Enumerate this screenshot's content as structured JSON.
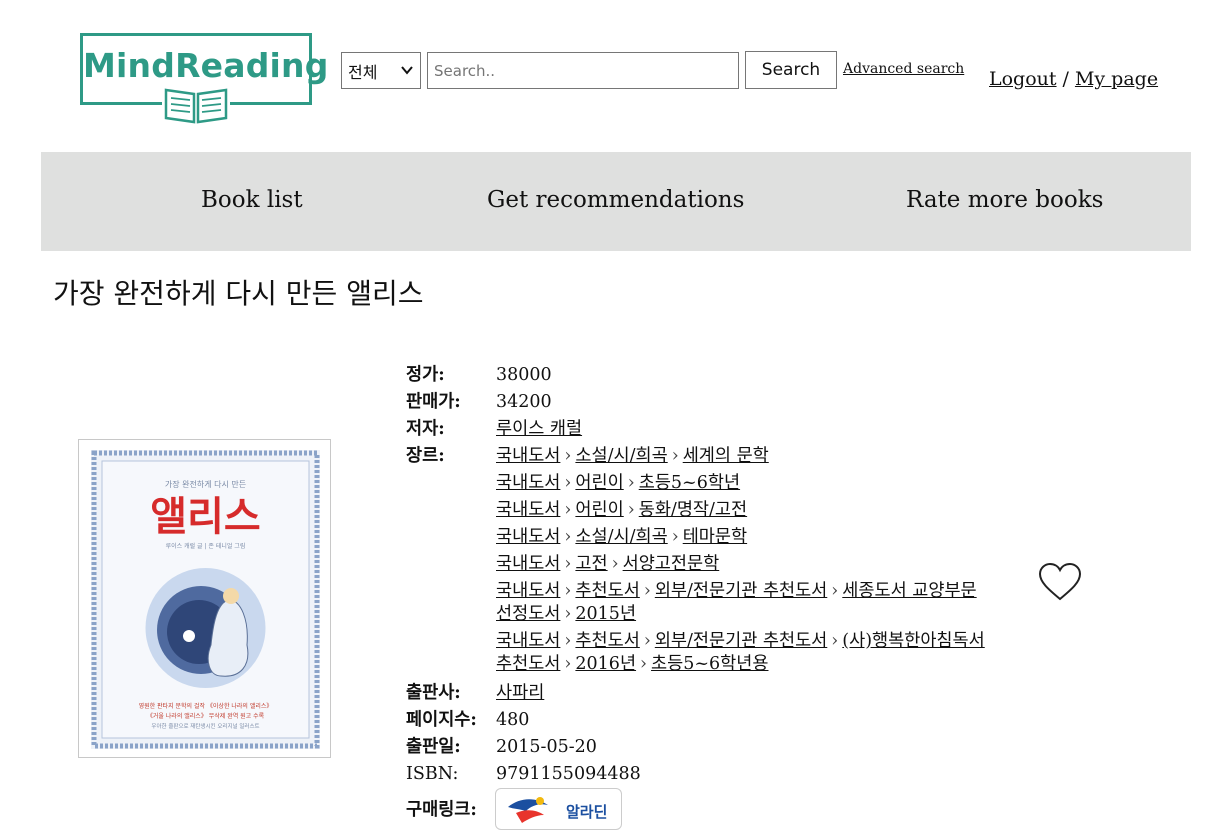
{
  "header": {
    "logo_text": "MindReading",
    "search_category": "전체",
    "search_placeholder": "Search..",
    "search_button": "Search",
    "advanced_search": "Advanced search",
    "logout": "Logout",
    "separator": "/",
    "my_page": "My page"
  },
  "nav": {
    "items": [
      {
        "label": "Book list"
      },
      {
        "label": "Get recommendations"
      },
      {
        "label": "Rate more books"
      }
    ]
  },
  "book": {
    "title": "가장 완전하게 다시 만든 앨리스",
    "cover": {
      "top_line": "가장 완전하게 다시 만든",
      "big_title": "앨리스",
      "credit": "루이스 캐럴 글 | 존 테니얼 그림",
      "blurb1": "영원한 판타지 문학의 걸작 《이상한 나라의 앨리스》",
      "blurb2": "《거울 나라의 앨리스》 무삭제 완역 원고 수록",
      "blurb3": "우아한 줄판으로 재탄생시킨 오리지널 일러스트"
    },
    "fields": {
      "list_price_label": "정가:",
      "list_price": "38000",
      "sale_price_label": "판매가:",
      "sale_price": "34200",
      "author_label": "저자:",
      "author": "루이스 캐럴",
      "genre_label": "장르:",
      "publisher_label": "출판사:",
      "publisher": "사파리",
      "pages_label": "페이지수:",
      "pages": "480",
      "pub_date_label": "출판일:",
      "pub_date": "2015-05-20",
      "isbn_label": "ISBN:",
      "isbn": "9791155094488",
      "buy_label": "구매링크:",
      "buy_store": "알라딘"
    },
    "genres": [
      {
        "g0": "국내도서",
        "g1": "소설/시/희곡",
        "g2": "세계의 문학"
      },
      {
        "g0": "국내도서",
        "g1": "어린이",
        "g2": "초등5~6학년"
      },
      {
        "g0": "국내도서",
        "g1": "어린이",
        "g2": "동화/명작/고전"
      },
      {
        "g0": "국내도서",
        "g1": "소설/시/희곡",
        "g2": "테마문학"
      },
      {
        "g0": "국내도서",
        "g1": "고전",
        "g2": "서양고전문학"
      },
      {
        "g0": "국내도서",
        "g1": "추천도서",
        "g2": "외부/전문기관 추천도서",
        "g3": "세종도서 교양부문 선정도서",
        "g4": "2015년"
      },
      {
        "g0": "국내도서",
        "g1": "추천도서",
        "g2": "외부/전문기관 추천도서",
        "g3": "(사)행복한아침독서 추천도서",
        "g4": "2016년",
        "g5": "초등5~6학년용"
      }
    ]
  },
  "colors": {
    "brand": "#2e9a86",
    "nav_bg": "#dfe0df",
    "cover_red": "#d62b2b"
  },
  "icons": {
    "favorite": "heart-outline-icon",
    "breadcrumb": "chevron-right-icon",
    "logo": "open-book-icon"
  }
}
